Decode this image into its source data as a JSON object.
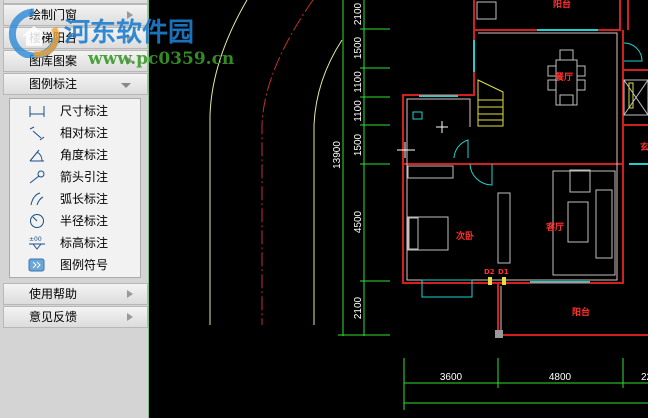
{
  "panel": {
    "menus_top": [
      {
        "label": "绘制门窗"
      },
      {
        "label": "楼梯阳台"
      },
      {
        "label": "图库图案"
      }
    ],
    "expanded": {
      "label": "图例标注",
      "items": [
        {
          "label": "尺寸标注",
          "icon": "dimension-icon"
        },
        {
          "label": "相对标注",
          "icon": "aligned-dimension-icon"
        },
        {
          "label": "角度标注",
          "icon": "angle-dimension-icon"
        },
        {
          "label": "箭头引注",
          "icon": "arrow-leader-icon"
        },
        {
          "label": "弧长标注",
          "icon": "arc-length-icon"
        },
        {
          "label": "半径标注",
          "icon": "radius-icon"
        },
        {
          "label": "标高标注",
          "icon": "elevation-icon"
        },
        {
          "label": "图例符号",
          "icon": "legend-symbol-icon"
        }
      ]
    },
    "menus_bottom": [
      {
        "label": "使用帮助"
      },
      {
        "label": "意见反馈"
      }
    ]
  },
  "cad": {
    "rooms": {
      "balcony_top": "阳台",
      "dining": "餐厅",
      "living": "客厅",
      "bedroom": "次卧",
      "balcony": "阳台",
      "entry": "玄"
    },
    "doors": {
      "d2": "D2",
      "d1": "D1"
    },
    "vertical_dims": [
      "2100",
      "1500",
      "1100",
      "1100",
      "1500",
      "4500",
      "2100"
    ],
    "total_dim": "13900",
    "horizontal_dims": [
      "3600",
      "4800",
      "22"
    ]
  },
  "watermark": {
    "name": "河东软件园",
    "url": "www.pc0359.cn"
  }
}
